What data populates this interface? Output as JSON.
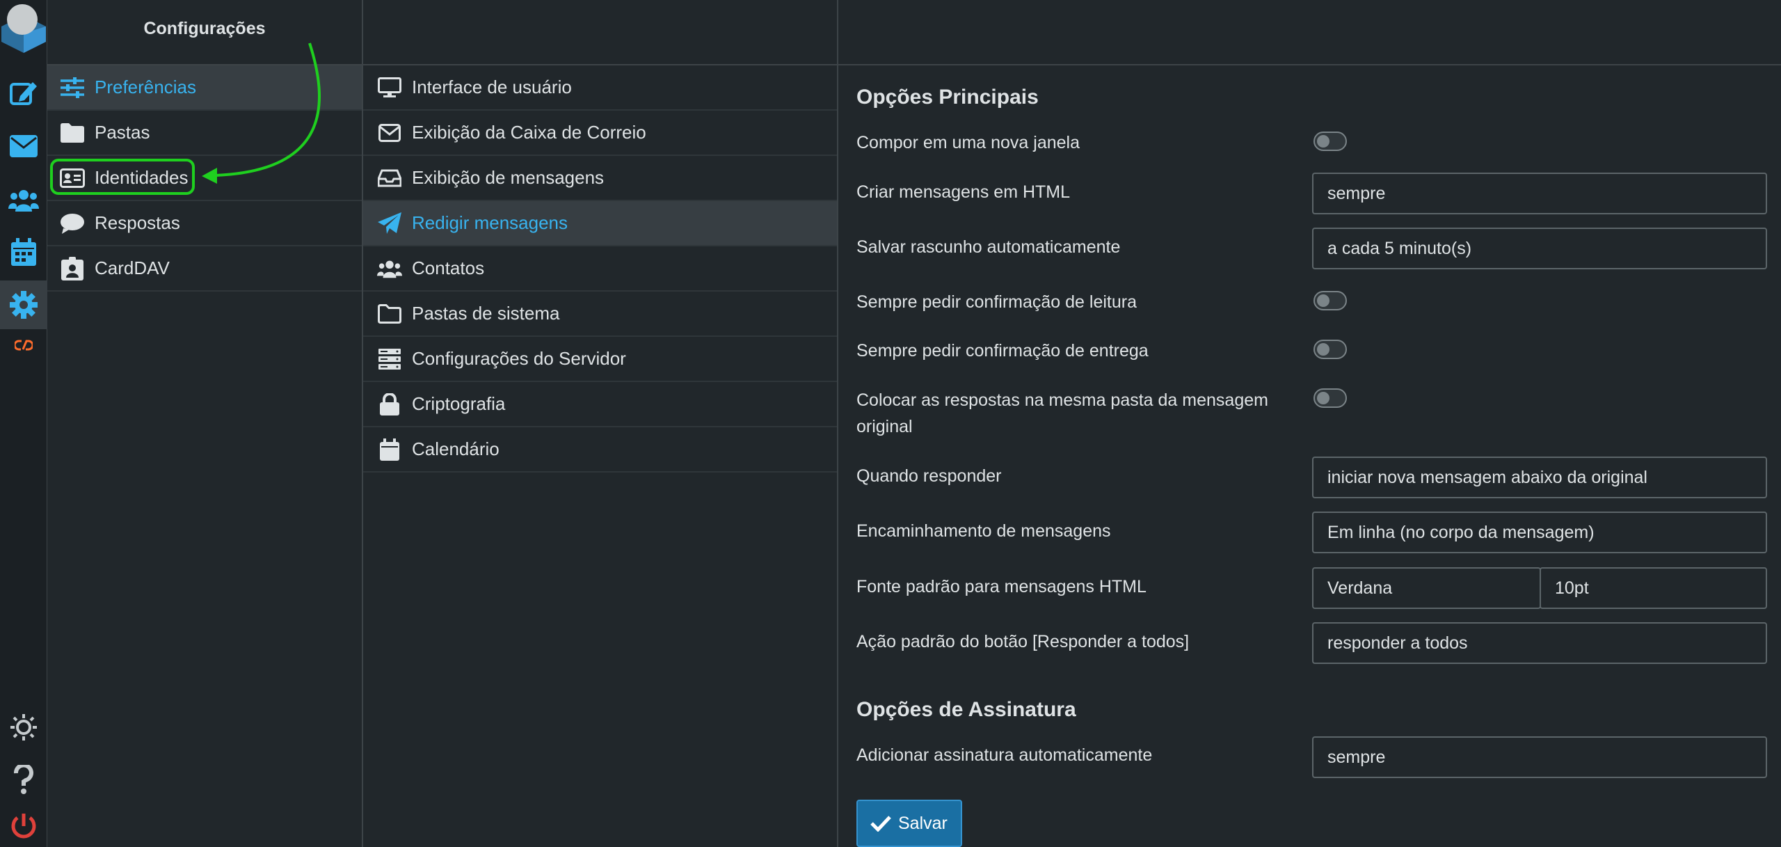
{
  "colors": {
    "accent": "#38b3ef",
    "highlight": "#1fcf1f",
    "save": "#1a6fa3",
    "logout": "#e0413b"
  },
  "rail": {
    "items": [
      {
        "icon": "compose-icon"
      },
      {
        "icon": "mail-icon"
      },
      {
        "icon": "contacts-icon"
      },
      {
        "icon": "calendar-icon"
      },
      {
        "icon": "settings-gear-icon"
      },
      {
        "icon": "cpanel-icon"
      },
      {
        "icon": "theme-sun-icon"
      },
      {
        "icon": "help-icon"
      },
      {
        "icon": "logout-icon"
      }
    ]
  },
  "settings": {
    "title": "Configurações",
    "items": [
      {
        "label": "Preferências",
        "icon": "sliders-icon"
      },
      {
        "label": "Pastas",
        "icon": "folder-icon"
      },
      {
        "label": "Identidades",
        "icon": "id-card-icon"
      },
      {
        "label": "Respostas",
        "icon": "comment-icon"
      },
      {
        "label": "CardDAV",
        "icon": "address-book-icon"
      }
    ]
  },
  "sections": {
    "items": [
      {
        "label": "Interface de usuário",
        "icon": "monitor-icon"
      },
      {
        "label": "Exibição da Caixa de Correio",
        "icon": "envelope-icon"
      },
      {
        "label": "Exibição de mensagens",
        "icon": "inbox-icon"
      },
      {
        "label": "Redigir mensagens",
        "icon": "paper-plane-icon"
      },
      {
        "label": "Contatos",
        "icon": "users-icon"
      },
      {
        "label": "Pastas de sistema",
        "icon": "folder-outline-icon"
      },
      {
        "label": "Configurações do Servidor",
        "icon": "server-icon"
      },
      {
        "label": "Criptografia",
        "icon": "lock-icon"
      },
      {
        "label": "Calendário",
        "icon": "calendar-icon"
      }
    ]
  },
  "form": {
    "main_title": "Opções Principais",
    "compose_new_window": {
      "label": "Compor em uma nova janela",
      "on": false
    },
    "html_messages": {
      "label": "Criar mensagens em HTML",
      "value": "sempre"
    },
    "autosave": {
      "label": "Salvar rascunho automaticamente",
      "value": "a cada 5 minuto(s)"
    },
    "read_receipt": {
      "label": "Sempre pedir confirmação de leitura",
      "on": false
    },
    "delivery_receipt": {
      "label": "Sempre pedir confirmação de entrega",
      "on": false
    },
    "replies_same_folder": {
      "label": "Colocar as respostas na mesma pasta da mensagem original",
      "on": false
    },
    "reply_mode": {
      "label": "Quando responder",
      "value": "iniciar nova mensagem abaixo da original"
    },
    "forward_mode": {
      "label": "Encaminhamento de mensagens",
      "value": "Em linha (no corpo da mensagem)"
    },
    "default_font": {
      "label": "Fonte padrão para mensagens HTML",
      "font": "Verdana",
      "size": "10pt"
    },
    "reply_all": {
      "label": "Ação padrão do botão [Responder a todos]",
      "value": "responder a todos"
    },
    "signature_title": "Opções de Assinatura",
    "auto_signature": {
      "label": "Adicionar assinatura automaticamente",
      "value": "sempre"
    },
    "save_label": "Salvar"
  }
}
